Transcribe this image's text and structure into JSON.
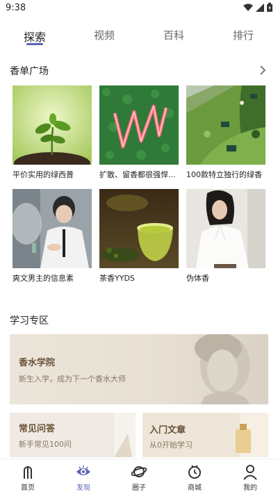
{
  "status": {
    "time": "9:38"
  },
  "top_tabs": [
    "探索",
    "视频",
    "百科",
    "排行"
  ],
  "sections": {
    "playlist_title": "香单广场",
    "study_title": "学习专区"
  },
  "playlists": [
    {
      "caption": "平价实用的绿西普",
      "image": "seedling-soil"
    },
    {
      "caption": "扩散、留香都很强悍...",
      "image": "neon-sign-on-grass"
    },
    {
      "caption": "100款特立独行的绿香",
      "image": "lawn-with-chairs"
    },
    {
      "caption": "爽文男主的信息素",
      "image": "man-with-smoke"
    },
    {
      "caption": "茶香YYDS",
      "image": "green-tea-glass"
    },
    {
      "caption": "伪体香",
      "image": "woman-white-shirt"
    }
  ],
  "study": {
    "academy": {
      "title": "香水学院",
      "subtitle": "新生入学，成为下一个香水大师"
    },
    "faq": {
      "title": "常见问答",
      "subtitle": "新手常见100问"
    },
    "intro": {
      "title": "入门文章",
      "subtitle": "从0开始学习"
    }
  },
  "bottom_nav": [
    {
      "label": "首页",
      "icon": "home-icon"
    },
    {
      "label": "发现",
      "icon": "eye-icon"
    },
    {
      "label": "圈子",
      "icon": "planet-icon"
    },
    {
      "label": "商城",
      "icon": "watch-icon"
    },
    {
      "label": "我的",
      "icon": "user-icon"
    }
  ],
  "colors": {
    "accent": "#5a63b4",
    "banner_text": "#6a5238"
  }
}
